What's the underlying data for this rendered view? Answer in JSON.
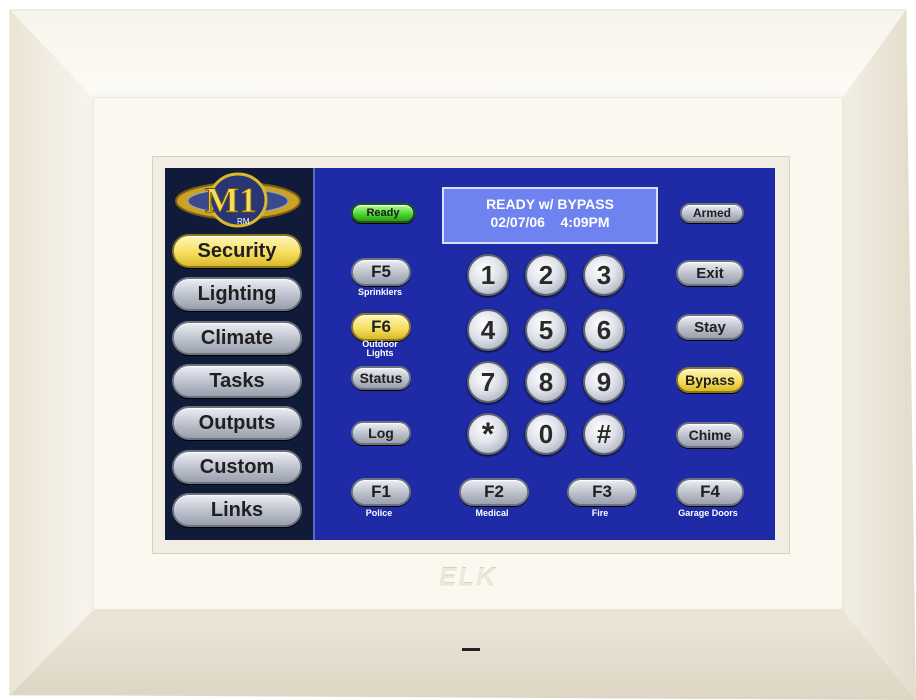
{
  "brand": {
    "logo_text": "M1",
    "logo_sub": "RM",
    "bezel_logo": "ELK"
  },
  "nav": {
    "items": [
      {
        "label": "Security",
        "active": true
      },
      {
        "label": "Lighting",
        "active": false
      },
      {
        "label": "Climate",
        "active": false
      },
      {
        "label": "Tasks",
        "active": false
      },
      {
        "label": "Outputs",
        "active": false
      },
      {
        "label": "Custom",
        "active": false
      },
      {
        "label": "Links",
        "active": false
      }
    ]
  },
  "status": {
    "ready_label": "Ready",
    "armed_label": "Armed",
    "display_line1": "READY w/ BYPASS",
    "display_line2": "02/07/06    4:09PM"
  },
  "left_keys": {
    "f5": {
      "label": "F5",
      "caption": "Sprinklers"
    },
    "f6": {
      "label": "F6",
      "caption_1": "Outdoor",
      "caption_2": "Lights"
    },
    "status": {
      "label": "Status"
    },
    "log": {
      "label": "Log"
    }
  },
  "keypad": {
    "k1": "1",
    "k2": "2",
    "k3": "3",
    "k4": "4",
    "k5": "5",
    "k6": "6",
    "k7": "7",
    "k8": "8",
    "k9": "9",
    "kstar": "*",
    "k0": "0",
    "khash": "#"
  },
  "right_keys": {
    "exit": "Exit",
    "stay": "Stay",
    "bypass": "Bypass",
    "chime": "Chime"
  },
  "function_keys": {
    "f1": {
      "label": "F1",
      "caption": "Police"
    },
    "f2": {
      "label": "F2",
      "caption": "Medical"
    },
    "f3": {
      "label": "F3",
      "caption": "Fire"
    },
    "f4": {
      "label": "F4",
      "caption": "Garage Doors"
    }
  },
  "colors": {
    "screen_bg": "#1f2aa6",
    "sidebar_bg": "#101b3a",
    "highlight_yellow": "#f4dc5a",
    "ready_green": "#46d62b"
  }
}
